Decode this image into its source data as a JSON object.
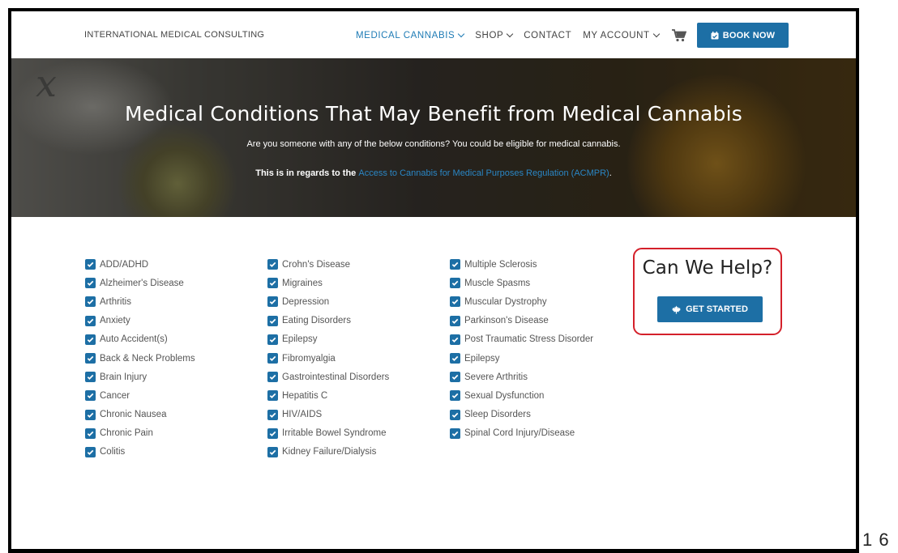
{
  "header": {
    "brand": "INTERNATIONAL MEDICAL CONSULTING",
    "nav": [
      {
        "label": "MEDICAL CANNABIS",
        "has_dropdown": true,
        "active": true
      },
      {
        "label": "SHOP",
        "has_dropdown": true,
        "active": false
      },
      {
        "label": "CONTACT",
        "has_dropdown": false,
        "active": false
      },
      {
        "label": "MY ACCOUNT",
        "has_dropdown": true,
        "active": false
      }
    ],
    "cart_icon": "cart-icon",
    "book_button": {
      "label": "BOOK NOW",
      "icon": "calendar-icon"
    }
  },
  "hero": {
    "title": "Medical Conditions That May Benefit from Medical Cannabis",
    "subtitle": "Are you someone with any of the below conditions? You could be eligible for medical cannabis.",
    "regulation_lead": "This is in regards to the ",
    "regulation_link": "Access to Cannabis for Medical Purposes Regulation (ACMPR)",
    "regulation_tail": "."
  },
  "conditions": {
    "col1": [
      "ADD/ADHD",
      "Alzheimer's Disease",
      "Arthritis",
      "Anxiety",
      "Auto Accident(s)",
      "Back & Neck Problems",
      "Brain Injury",
      "Cancer",
      "Chronic Nausea",
      "Chronic Pain",
      "Colitis"
    ],
    "col2": [
      "Crohn's Disease",
      "Migraines",
      "Depression",
      "Eating Disorders",
      "Epilepsy",
      "Fibromyalgia",
      "Gastrointestinal Disorders",
      "Hepatitis C",
      "HIV/AIDS",
      "Irritable Bowel Syndrome",
      "Kidney Failure/Dialysis"
    ],
    "col3": [
      "Multiple Sclerosis",
      "Muscle Spasms",
      "Muscular Dystrophy",
      "Parkinson's Disease",
      "Post Traumatic Stress Disorder",
      "Epilepsy",
      "Severe Arthritis",
      "Sexual Dysfunction",
      "Sleep Disorders",
      "Spinal Cord Injury/Disease"
    ]
  },
  "cta": {
    "title": "Can We Help?",
    "button_label": "GET STARTED",
    "button_icon": "maple-leaf-icon"
  },
  "page_number": "1 6",
  "colors": {
    "primary": "#1d6fa5",
    "active_nav": "#1e7bb5",
    "highlight": "#d4202a"
  }
}
